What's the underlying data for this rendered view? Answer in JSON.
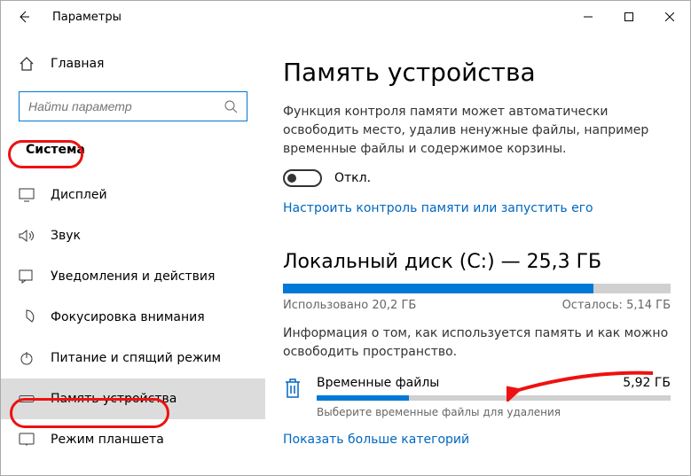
{
  "window": {
    "title": "Параметры"
  },
  "sidebar": {
    "home": "Главная",
    "search_placeholder": "Найти параметр",
    "section": "Система",
    "items": [
      {
        "icon": "display-icon",
        "label": "Дисплей"
      },
      {
        "icon": "sound-icon",
        "label": "Звук"
      },
      {
        "icon": "notifications-icon",
        "label": "Уведомления и действия"
      },
      {
        "icon": "focus-icon",
        "label": "Фокусировка внимания"
      },
      {
        "icon": "power-icon",
        "label": "Питание и спящий режим"
      },
      {
        "icon": "storage-icon",
        "label": "Память устройства"
      },
      {
        "icon": "tablet-icon",
        "label": "Режим планшета"
      }
    ]
  },
  "main": {
    "heading": "Память устройства",
    "description": "Функция контроля памяти может автоматически освободить место, удалив ненужные файлы, например временные файлы и содержимое корзины.",
    "toggle_label": "Откл.",
    "configure_link": "Настроить контроль памяти или запустить его",
    "disk": {
      "title": "Локальный диск (C:) — 25,3 ГБ",
      "used_label": "Использовано 20,2 ГБ",
      "free_label": "Осталось: 5,14 ГБ",
      "used_pct": 80
    },
    "usage_desc": "Информация о том, как используется память и как можно освободить пространство.",
    "temp": {
      "title": "Временные файлы",
      "size": "5,92 ГБ",
      "bar_pct": 26,
      "hint": "Выберите временные файлы для удаления"
    },
    "more_link": "Показать больше категорий"
  }
}
